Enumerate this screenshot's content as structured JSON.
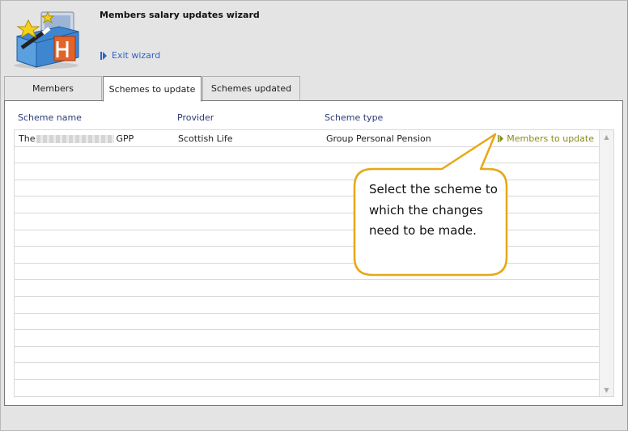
{
  "header": {
    "title": "Members salary updates wizard",
    "exit_label": "Exit wizard"
  },
  "tabs": [
    {
      "label": "Members",
      "active": false
    },
    {
      "label": "Schemes to update",
      "active": true
    },
    {
      "label": "Schemes updated",
      "active": false
    }
  ],
  "table": {
    "columns": [
      "Scheme name",
      "Provider",
      "Scheme type"
    ],
    "rows": [
      {
        "scheme_name_prefix": "The",
        "scheme_name_suffix": "GPP",
        "provider": "Scottish Life",
        "scheme_type": "Group Personal Pension",
        "action_label": "Members to update"
      }
    ]
  },
  "callout": {
    "text": "Select the scheme to which the changes need to be made."
  },
  "colors": {
    "link_blue": "#2f64c8",
    "action_olive": "#8a8c1a",
    "column_header": "#2b3b78",
    "callout_border": "#e6a817"
  },
  "icons": {
    "logo": "wizard-toolbox-icon",
    "exit": "play-arrow-icon",
    "row_action": "play-arrow-icon"
  }
}
